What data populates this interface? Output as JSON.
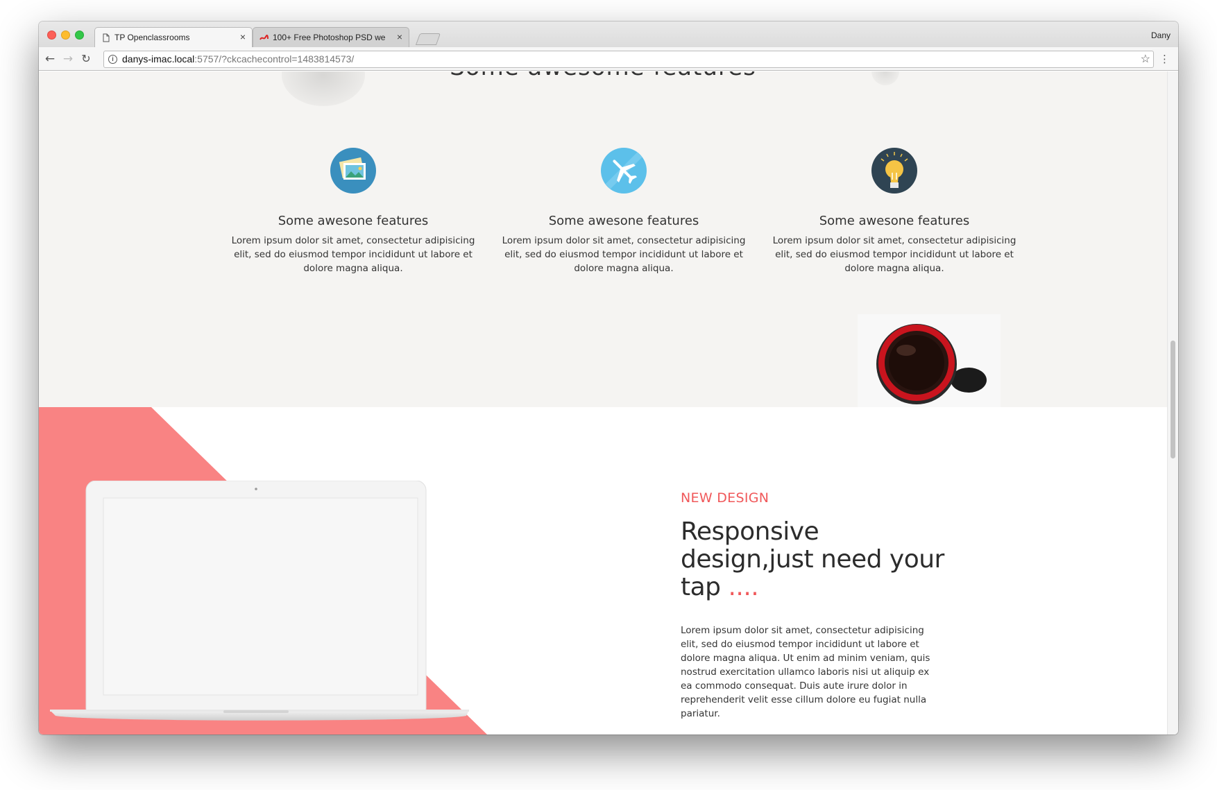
{
  "browser": {
    "tabs": [
      {
        "title": "TP Openclassrooms",
        "close": "×"
      },
      {
        "title": "100+ Free Photoshop PSD we",
        "close": "×"
      }
    ],
    "user": "Dany",
    "url_host": "danys-imac.local",
    "url_path": ":5757/?ckcachecontrol=1483814573/"
  },
  "features": {
    "heading_partial": "Some awesome features",
    "items": [
      {
        "title": "Some awesone features",
        "text": "Lorem ipsum dolor sit amet, consectetur adipisicing elit, sed do eiusmod tempor incididunt ut labore et dolore magna aliqua.",
        "icon": "picture-icon"
      },
      {
        "title": "Some awesone features",
        "text": "Lorem ipsum dolor sit amet, consectetur adipisicing elit, sed do eiusmod tempor incididunt ut labore et dolore magna aliqua.",
        "icon": "airplane-icon"
      },
      {
        "title": "Some awesone features",
        "text": "Lorem ipsum dolor sit amet, consectetur adipisicing elit, sed do eiusmod tempor incididunt ut labore et dolore magna aliqua.",
        "icon": "lightbulb-icon"
      }
    ]
  },
  "design": {
    "eyebrow": "NEW DESIGN",
    "headline": "Responsive design,just need your tap",
    "headline_dots": " ....",
    "body": "Lorem ipsum dolor sit amet, consectetur adipisicing elit, sed do eiusmod tempor incididunt ut labore et dolore magna aliqua. Ut enim ad minim veniam, quis nostrud exercitation ullamco laboris nisi ut aliquip ex ea commodo consequat. Duis aute irure dolor in reprehenderit velit esse cillum dolore eu fugiat nulla pariatur."
  },
  "colors": {
    "accent": "#f0585a",
    "pink_bg": "#f98383",
    "features_bg": "#f5f4f2"
  }
}
